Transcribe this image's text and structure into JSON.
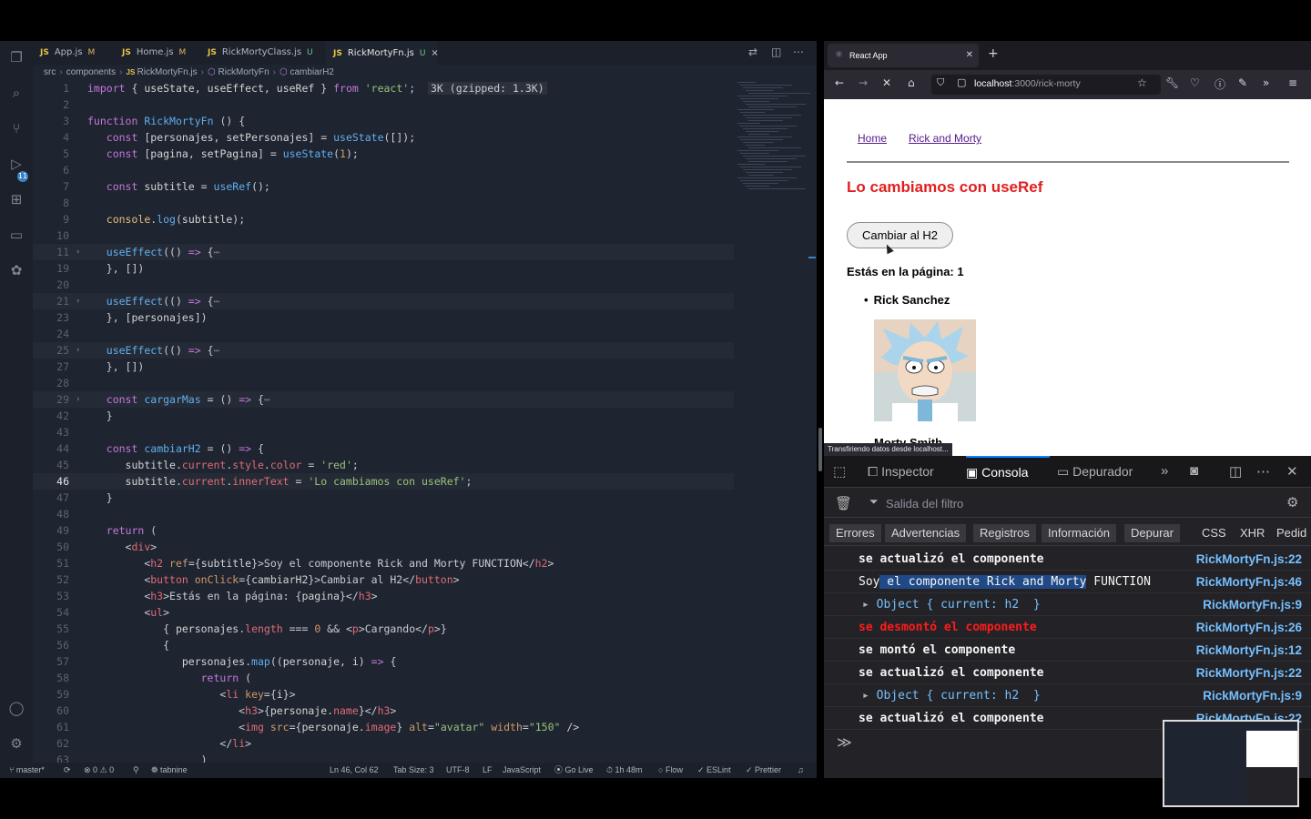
{
  "vscode": {
    "tabs": [
      {
        "label": "App.js",
        "flag": "M",
        "active": false
      },
      {
        "label": "Home.js",
        "flag": "M",
        "active": false
      },
      {
        "label": "RickMortyClass.js",
        "flag": "U",
        "active": false
      },
      {
        "label": "RickMortyFn.js",
        "flag": "U",
        "active": true
      }
    ],
    "breadcrumb": [
      "src",
      "components",
      "RickMortyFn.js",
      "RickMortyFn",
      "cambiarH2"
    ],
    "scm_badge": "11",
    "status": {
      "branch": "master*",
      "problems": "0",
      "warnings": "0",
      "tabnine": "tabnine",
      "position": "Ln 46, Col 62",
      "tabsize": "Tab Size: 3",
      "encoding": "UTF-8",
      "eol": "LF",
      "language": "JavaScript",
      "golive": "Go Live",
      "time": "1h 48m",
      "flow": "Flow",
      "eslint": "ESLint",
      "prettier": "Prettier"
    },
    "code_lines": [
      {
        "n": "1",
        "html": "<span class='k'>import</span> <span class='p'>{ </span><span class='v'>useState</span><span class='p'>, </span><span class='v'>useEffect</span><span class='p'>, </span><span class='v'>useRef</span><span class='p'> } </span><span class='k'>from</span> <span class='str'>'react'</span><span class='p'>;</span>  <span class='badge'>3K (gzipped: 1.3K)</span>"
      },
      {
        "n": "2",
        "html": ""
      },
      {
        "n": "3",
        "html": "<span class='k'>function</span> <span class='f'>RickMortyFn</span> <span class='p'>() {</span>"
      },
      {
        "n": "4",
        "html": "   <span class='k'>const</span> <span class='p'>[</span><span class='v'>personajes</span><span class='p'>, </span><span class='v'>setPersonajes</span><span class='p'>] = </span><span class='f'>useState</span><span class='p'>([]);</span>"
      },
      {
        "n": "5",
        "html": "   <span class='k'>const</span> <span class='p'>[</span><span class='v'>pagina</span><span class='p'>, </span><span class='v'>setPagina</span><span class='p'>] = </span><span class='f'>useState</span><span class='p'>(</span><span class='n'>1</span><span class='p'>);</span>"
      },
      {
        "n": "6",
        "html": ""
      },
      {
        "n": "7",
        "html": "   <span class='k'>const</span> <span class='v'>subtitle</span> <span class='p'>= </span><span class='f'>useRef</span><span class='p'>();</span>"
      },
      {
        "n": "8",
        "html": ""
      },
      {
        "n": "9",
        "html": "   <span class='s'>console</span><span class='p'>.</span><span class='f'>log</span><span class='p'>(</span><span class='v'>subtitle</span><span class='p'>);</span>"
      },
      {
        "n": "10",
        "html": ""
      },
      {
        "n": "11",
        "fold": true,
        "hl": true,
        "html": "   <span class='f'>useEffect</span><span class='p'>(() </span><span class='k'>=></span><span class='p'> {</span><span class='c'>⋯</span>"
      },
      {
        "n": "19",
        "html": "   <span class='p'>}, [])</span>"
      },
      {
        "n": "20",
        "html": ""
      },
      {
        "n": "21",
        "fold": true,
        "hl": true,
        "html": "   <span class='f'>useEffect</span><span class='p'>(() </span><span class='k'>=></span><span class='p'> {</span><span class='c'>⋯</span>"
      },
      {
        "n": "23",
        "html": "   <span class='p'>}, [</span><span class='v'>personajes</span><span class='p'>])</span>"
      },
      {
        "n": "24",
        "html": ""
      },
      {
        "n": "25",
        "fold": true,
        "hl": true,
        "html": "   <span class='f'>useEffect</span><span class='p'>(() </span><span class='k'>=></span><span class='p'> {</span><span class='c'>⋯</span>"
      },
      {
        "n": "27",
        "html": "   <span class='p'>}, [])</span>"
      },
      {
        "n": "28",
        "html": ""
      },
      {
        "n": "29",
        "fold": true,
        "hl": true,
        "html": "   <span class='k'>const</span> <span class='f'>cargarMas</span> <span class='p'>= () </span><span class='k'>=></span><span class='p'> {</span><span class='c'>⋯</span>"
      },
      {
        "n": "42",
        "html": "   <span class='p'>}</span>"
      },
      {
        "n": "43",
        "html": ""
      },
      {
        "n": "44",
        "html": "   <span class='k'>const</span> <span class='f'>cambiarH2</span> <span class='p'>= () </span><span class='k'>=></span><span class='p'> {</span>"
      },
      {
        "n": "45",
        "html": "      <span class='v'>subtitle</span><span class='p'>.</span><span class='prop'>current</span><span class='p'>.</span><span class='prop'>style</span><span class='p'>.</span><span class='prop'>color</span><span class='p'> = </span><span class='str'>'red'</span><span class='p'>;</span>"
      },
      {
        "n": "46",
        "cur": true,
        "hl": true,
        "html": "      <span class='v'>subtitle</span><span class='p'>.</span><span class='prop'>current</span><span class='p'>.</span><span class='prop'>innerText</span><span class='p'> = </span><span class='str'>'Lo cambiamos con useRef'</span><span class='p'>;</span>"
      },
      {
        "n": "47",
        "html": "   <span class='p'>}</span>"
      },
      {
        "n": "48",
        "html": ""
      },
      {
        "n": "49",
        "html": "   <span class='k'>return</span> <span class='p'>(</span>"
      },
      {
        "n": "50",
        "html": "      <span class='p'>&lt;</span><span class='t'>div</span><span class='p'>&gt;</span>"
      },
      {
        "n": "51",
        "html": "         <span class='p'>&lt;</span><span class='t'>h2</span> <span class='a'>ref</span><span class='p'>={</span><span class='v'>subtitle</span><span class='p'>}&gt;Soy el componente Rick and Morty FUNCTION&lt;/</span><span class='t'>h2</span><span class='p'>&gt;</span>"
      },
      {
        "n": "52",
        "html": "         <span class='p'>&lt;</span><span class='t'>button</span> <span class='a'>onClick</span><span class='p'>={</span><span class='v'>cambiarH2</span><span class='p'>}&gt;Cambiar al H2&lt;/</span><span class='t'>button</span><span class='p'>&gt;</span>"
      },
      {
        "n": "53",
        "html": "         <span class='p'>&lt;</span><span class='t'>h3</span><span class='p'>&gt;Estás en la página: {</span><span class='v'>pagina</span><span class='p'>}&lt;/</span><span class='t'>h3</span><span class='p'>&gt;</span>"
      },
      {
        "n": "54",
        "html": "         <span class='p'>&lt;</span><span class='t'>ul</span><span class='p'>&gt;</span>"
      },
      {
        "n": "55",
        "html": "            <span class='p'>{ </span><span class='v'>personajes</span><span class='p'>.</span><span class='prop'>length</span><span class='p'> === </span><span class='n'>0</span><span class='p'> &amp;&amp; &lt;</span><span class='t'>p</span><span class='p'>&gt;Cargando&lt;/</span><span class='t'>p</span><span class='p'>&gt;}</span>"
      },
      {
        "n": "56",
        "html": "            <span class='p'>{</span>"
      },
      {
        "n": "57",
        "html": "               <span class='v'>personajes</span><span class='p'>.</span><span class='f'>map</span><span class='p'>((</span><span class='v'>personaje</span><span class='p'>, </span><span class='v'>i</span><span class='p'>) </span><span class='k'>=></span><span class='p'> {</span>"
      },
      {
        "n": "58",
        "html": "                  <span class='k'>return</span> <span class='p'>(</span>"
      },
      {
        "n": "59",
        "html": "                     <span class='p'>&lt;</span><span class='t'>li</span> <span class='a'>key</span><span class='p'>={</span><span class='v'>i</span><span class='p'>}&gt;</span>"
      },
      {
        "n": "60",
        "html": "                        <span class='p'>&lt;</span><span class='t'>h3</span><span class='p'>&gt;{</span><span class='v'>personaje</span><span class='p'>.</span><span class='prop'>name</span><span class='p'>}&lt;/</span><span class='t'>h3</span><span class='p'>&gt;</span>"
      },
      {
        "n": "61",
        "html": "                        <span class='p'>&lt;</span><span class='t'>img</span> <span class='a'>src</span><span class='p'>={</span><span class='v'>personaje</span><span class='p'>.</span><span class='prop'>image</span><span class='p'>} </span><span class='a'>alt</span><span class='p'>=</span><span class='str'>\"avatar\"</span> <span class='a'>width</span><span class='p'>=</span><span class='str'>\"150\"</span><span class='p'> /&gt;</span>"
      },
      {
        "n": "62",
        "html": "                     <span class='p'>&lt;/</span><span class='t'>li</span><span class='p'>&gt;</span>"
      },
      {
        "n": "63",
        "html": "                  <span class='p'>)</span>"
      }
    ]
  },
  "firefox": {
    "tab_title": "React App",
    "url_host": "localhost",
    "url_rest": ":3000/rick-morty",
    "page": {
      "nav_home": "Home",
      "nav_rick": "Rick and Morty",
      "h2": "Lo cambiamos con useRef",
      "button": "Cambiar al H2",
      "h3": "Estás en la página: 1",
      "char1": "Rick Sanchez",
      "char2": "Morty Smith"
    },
    "status_tip": "Transfiriendo datos desde localhost...",
    "devtools": {
      "tabs": [
        "Inspector",
        "Consola",
        "Depurador"
      ],
      "filter_placeholder": "Salida del filtro",
      "categories": [
        "Errores",
        "Advertencias",
        "Registros",
        "Información",
        "Depurar",
        "CSS",
        "XHR",
        "Pedid"
      ],
      "messages": [
        {
          "text": "se actualizó el componente",
          "src": "RickMortyFn.js:22",
          "kind": "log"
        },
        {
          "text": "Soy el componente Rick and Morty FUNCTION",
          "src": "RickMortyFn.js:46",
          "kind": "log-plain"
        },
        {
          "text": "Object { current: h2  }",
          "src": "RickMortyFn.js:9",
          "kind": "obj"
        },
        {
          "text": "se desmontó el componente",
          "src": "RickMortyFn.js:26",
          "kind": "red"
        },
        {
          "text": "se montó el componente",
          "src": "RickMortyFn.js:12",
          "kind": "log"
        },
        {
          "text": "se actualizó el componente",
          "src": "RickMortyFn.js:22",
          "kind": "log"
        },
        {
          "text": "Object { current: h2  }",
          "src": "RickMortyFn.js:9",
          "kind": "obj"
        },
        {
          "text": "se actualizó el componente",
          "src": "RickMortyFn.js:22",
          "kind": "log"
        }
      ]
    }
  }
}
